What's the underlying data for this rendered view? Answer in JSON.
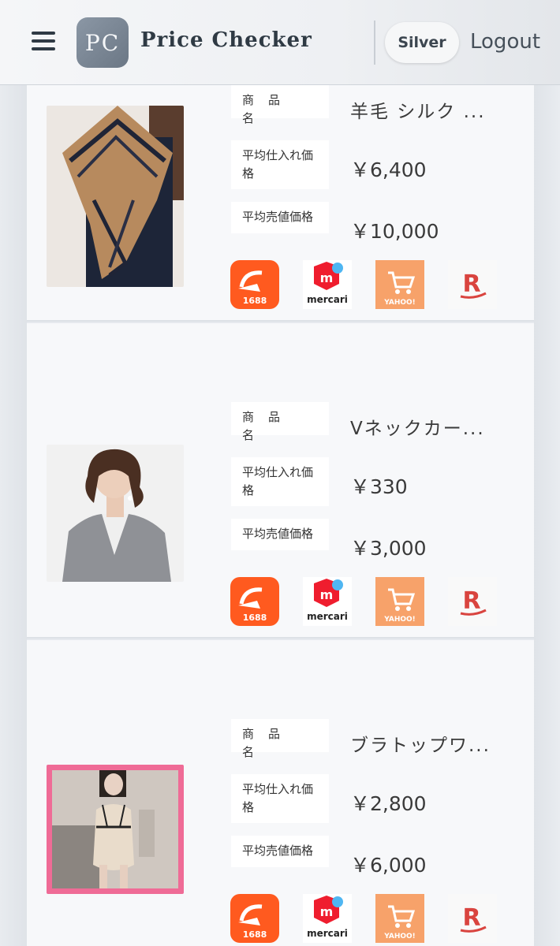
{
  "header": {
    "logo_text": "PC",
    "title": "Price Checker",
    "plan": "Silver",
    "logout": "Logout"
  },
  "labels": {
    "name": "商品名",
    "avg_cost": "平均仕入れ価格",
    "avg_sell": "平均売値価格"
  },
  "shops": {
    "s1688": "1688",
    "mercari": "mercari",
    "yahoo": "YAHOO!",
    "rakuten": "R"
  },
  "products": [
    {
      "name": "羊毛 シルク ...",
      "avg_cost": "￥6,400",
      "avg_sell": "￥10,000"
    },
    {
      "name": "Vネックカー...",
      "avg_cost": "￥330",
      "avg_sell": "￥3,000"
    },
    {
      "name": "ブラトップワ...",
      "avg_cost": "￥2,800",
      "avg_sell": "￥6,000"
    }
  ],
  "colors": {
    "s1688_orange": "#ff5a1f",
    "mercari_red": "#ef1d2e",
    "mercari_blue": "#4fb6f2",
    "yahoo_orange": "#f7a26a",
    "rakuten_red": "#d9443f",
    "pink_frame": "#ef6b96"
  }
}
